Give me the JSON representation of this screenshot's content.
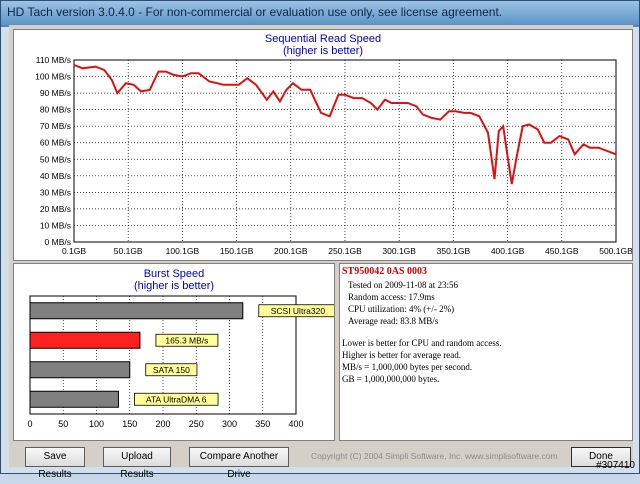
{
  "window": {
    "title": "HD Tach version 3.0.4.0  - For non-commercial or evaluation use only, see license agreement."
  },
  "sequential": {
    "title": "Sequential Read Speed",
    "subtitle": "(higher is better)"
  },
  "burst": {
    "title": "Burst Speed",
    "subtitle": "(higher is better)"
  },
  "info": {
    "drive": "ST950042 0AS 0003",
    "tested_on": "Tested on 2009-11-08 at 23:56",
    "random_access": "Random access: 17.9ms",
    "cpu": "CPU utilization: 4% (+/- 2%)",
    "average": "Average read: 83.8 MB/s",
    "note1": "Lower is better for CPU and random access.",
    "note2": "Higher is better for average read.",
    "note3": "MB/s = 1,000,000 bytes per second.",
    "note4": "GB = 1,000,000,000 bytes."
  },
  "buttons": {
    "save": "Save Results",
    "upload": "Upload Results",
    "compare": "Compare Another Drive",
    "done": "Done"
  },
  "copyright": "Copyright (C) 2004 Simpli Software, Inc. www.simplisoftware.com",
  "watermark": "#307410",
  "colors": {
    "line": "#e01010",
    "bar_highlight": "#ff2020",
    "bar_gray": "#808080",
    "label_bg": "#ffff99"
  },
  "chart_data": [
    {
      "type": "line",
      "title": "Sequential Read Speed",
      "subtitle": "(higher is better)",
      "xlim": [
        0.1,
        500.1
      ],
      "ylim": [
        0,
        110
      ],
      "x_ticks": [
        "0.1GB",
        "50.1GB",
        "100.1GB",
        "150.1GB",
        "200.1GB",
        "250.1GB",
        "300.1GB",
        "350.1GB",
        "400.1GB",
        "450.1GB",
        "500.1GB"
      ],
      "x_tick_values": [
        0.1,
        50.1,
        100.1,
        150.1,
        200.1,
        250.1,
        300.1,
        350.1,
        400.1,
        450.1,
        500.1
      ],
      "y_ticks": [
        "0 MB/s",
        "10 MB/s",
        "20 MB/s",
        "30 MB/s",
        "40 MB/s",
        "50 MB/s",
        "60 MB/s",
        "70 MB/s",
        "80 MB/s",
        "90 MB/s",
        "100 MB/s",
        "110 MB/s"
      ],
      "y_tick_values": [
        0,
        10,
        20,
        30,
        40,
        50,
        60,
        70,
        80,
        90,
        100,
        110
      ],
      "grid": true,
      "series": [
        {
          "x": [
            0.1,
            8,
            20,
            28,
            35,
            40,
            48,
            55,
            62,
            70,
            78,
            85,
            92,
            100,
            108,
            115,
            125,
            132,
            138,
            146,
            152,
            160,
            168,
            178,
            184,
            190,
            196,
            202,
            210,
            218,
            228,
            236,
            244,
            250,
            258,
            266,
            274,
            280,
            287,
            293,
            300,
            308,
            316,
            322,
            330,
            338,
            346,
            352,
            360,
            366,
            374,
            382,
            388,
            392,
            396,
            400,
            404,
            408,
            414,
            420,
            428,
            434,
            440,
            448,
            456,
            462,
            470,
            476,
            484,
            492,
            500.1
          ],
          "y": [
            107,
            105,
            106,
            104,
            98,
            90,
            96,
            95,
            91,
            92,
            103,
            103,
            101,
            100,
            102,
            102,
            97,
            96,
            95,
            95,
            95,
            99,
            95,
            86,
            91,
            85,
            92,
            96,
            92,
            92,
            78,
            76,
            89,
            89,
            87,
            87,
            84,
            80,
            86,
            84,
            84,
            84,
            82,
            77,
            75,
            74,
            79,
            79,
            78,
            78,
            76,
            66,
            38,
            67,
            70,
            52,
            35,
            50,
            70,
            71,
            68,
            60,
            60,
            64,
            62,
            53,
            59,
            57,
            57,
            55,
            53
          ]
        }
      ]
    },
    {
      "type": "bar",
      "orientation": "horizontal",
      "title": "Burst Speed",
      "subtitle": "(higher is better)",
      "xlim": [
        0,
        400
      ],
      "x_ticks": [
        "0",
        "50",
        "100",
        "150",
        "200",
        "250",
        "300",
        "350",
        "400"
      ],
      "x_tick_values": [
        0,
        50,
        100,
        150,
        200,
        250,
        300,
        350,
        400
      ],
      "categories": [
        "SCSI Ultra320",
        "165.3 MB/s",
        "SATA 150",
        "ATA UltraDMA 6"
      ],
      "values": [
        320,
        165.3,
        150,
        133
      ],
      "highlight_index": 1
    }
  ]
}
